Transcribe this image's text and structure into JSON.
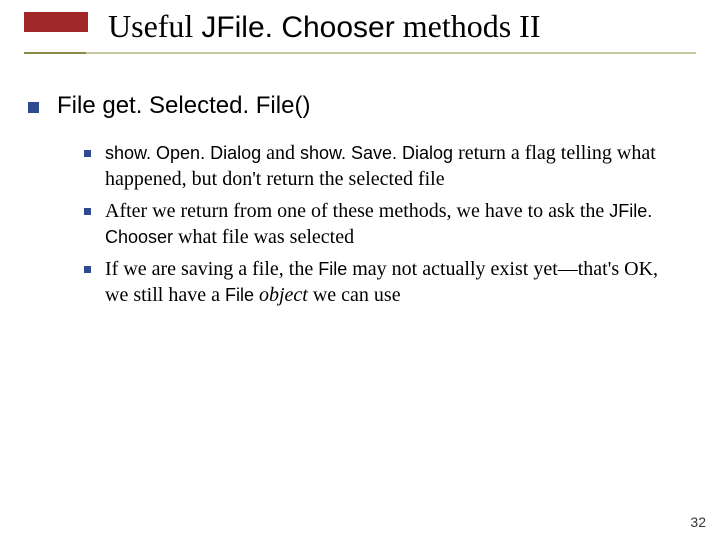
{
  "title": {
    "pre": "Useful ",
    "code": "JFile. Chooser",
    "post": " methods II"
  },
  "heading": "File get. Selected. File()",
  "bullets": [
    {
      "code1": "show. Open. Dialog",
      "mid1": " and ",
      "code2": "show. Save. Dialog",
      "rest": " return a flag telling what happened, but don't return the selected file"
    },
    {
      "pre": "After we return from one of these methods, we have to ask the ",
      "code": "JFile. Chooser",
      "post": " what file was selected"
    },
    {
      "pre": "If we are saving a file, the ",
      "file1": "File",
      "mid": " may not actually exist yet—that's OK, we still have a ",
      "file2": "File",
      "obj": " object",
      "post": " we can use"
    }
  ],
  "pagenum": "32"
}
